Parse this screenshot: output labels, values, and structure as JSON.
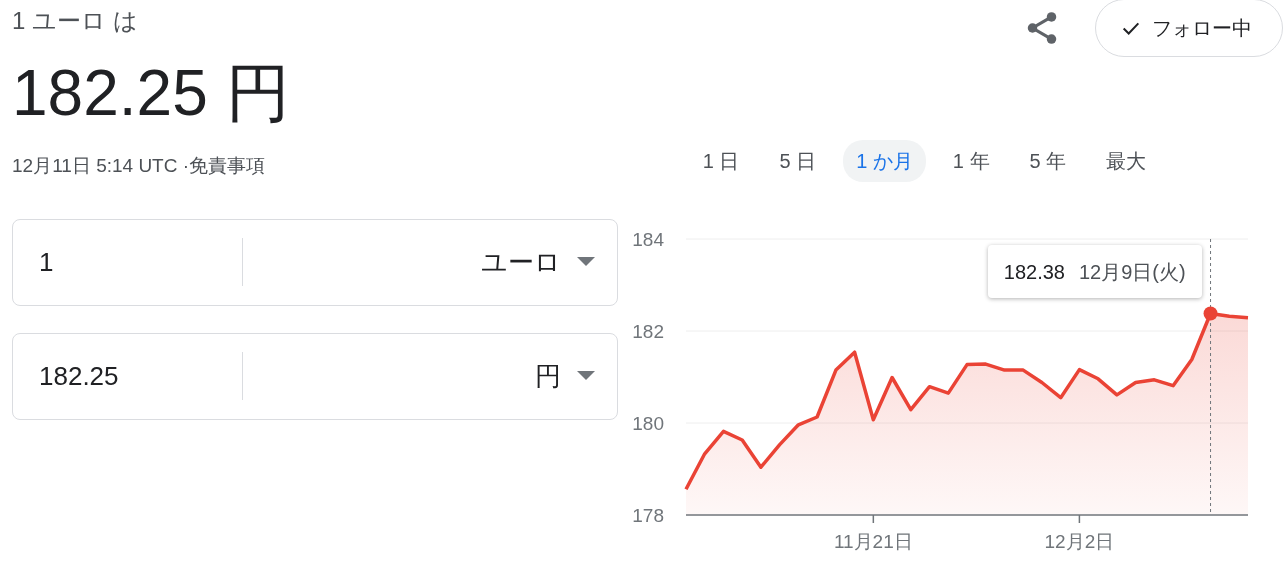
{
  "header": {
    "subtitle": "1 ユーロ は",
    "result": "182.25 円",
    "timestamp": "12月11日 5:14 UTC · ",
    "disclaimer": "免責事項"
  },
  "follow_button": {
    "label": "フォロー中",
    "checked": true
  },
  "tabs": [
    {
      "label": "1 日",
      "selected": false
    },
    {
      "label": "5 日",
      "selected": false
    },
    {
      "label": "1 か月",
      "selected": true
    },
    {
      "label": "1 年",
      "selected": false
    },
    {
      "label": "5 年",
      "selected": false
    },
    {
      "label": "最大",
      "selected": false
    }
  ],
  "converter": [
    {
      "amount": "1",
      "currency": "ユーロ"
    },
    {
      "amount": "182.25",
      "currency": "円"
    }
  ],
  "chart": {
    "chart_data": {
      "type": "area",
      "categories": [
        null,
        null,
        null,
        null,
        null,
        null,
        null,
        null,
        null,
        null,
        "11月21日",
        null,
        null,
        null,
        null,
        null,
        null,
        null,
        null,
        null,
        null,
        "12月2日",
        null,
        null,
        null,
        null,
        null,
        null,
        null,
        null,
        null
      ],
      "series": [
        {
          "color": "#ea4335",
          "values": [
            178.56,
            179.33,
            179.82,
            179.63,
            179.04,
            179.53,
            179.96,
            180.13,
            181.15,
            181.54,
            180.07,
            180.99,
            180.29,
            180.79,
            180.65,
            181.27,
            181.28,
            181.15,
            181.15,
            180.88,
            180.55,
            181.16,
            180.96,
            180.61,
            180.88,
            180.94,
            180.81,
            181.38,
            182.38,
            182.32,
            182.29
          ]
        }
      ],
      "ylim": [
        178,
        184
      ],
      "yticks": [
        178,
        180,
        182,
        184
      ],
      "annotations": [
        "182.38"
      ]
    },
    "tooltip": {
      "date": "12月9日(火)"
    }
  }
}
